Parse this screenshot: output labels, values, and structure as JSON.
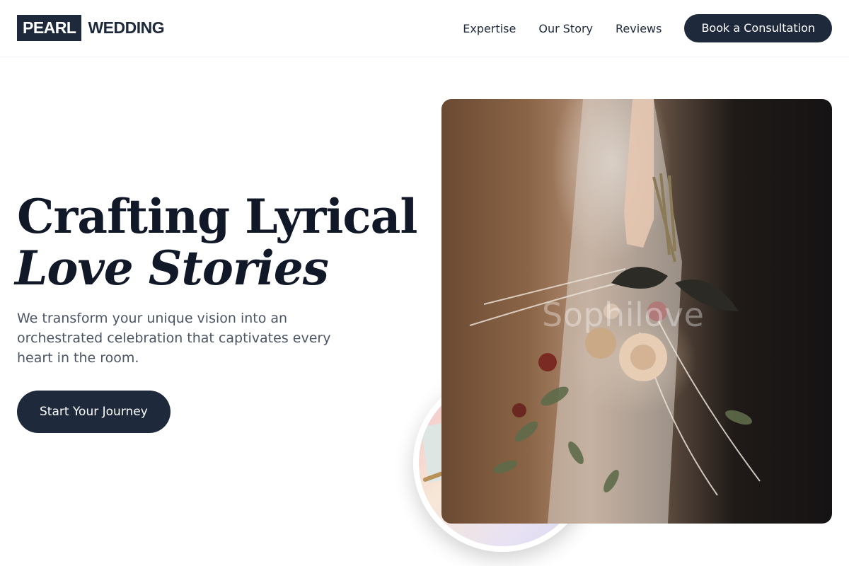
{
  "header": {
    "logo_box": "PEARL",
    "logo_text": "WEDDING",
    "nav": [
      "Expertise",
      "Our Story",
      "Reviews"
    ],
    "cta": "Book a Consultation"
  },
  "hero": {
    "title_line1": "Crafting Lyrical",
    "title_line2": "Love Stories",
    "subtitle": "We transform your unique vision into an orchestrated celebration that captivates every heart in the room.",
    "cta": "Start Your Journey"
  },
  "images": {
    "main_overlay_text": "Sophilove"
  },
  "colors": {
    "primary": "#1e293b",
    "heading": "#111827",
    "body_text": "#4b5563"
  }
}
